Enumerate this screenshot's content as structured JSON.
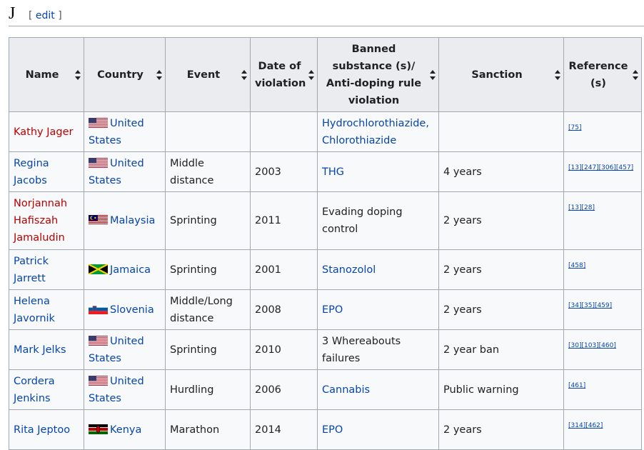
{
  "heading": {
    "title": "J",
    "edit_label": "edit",
    "open_bracket": "[",
    "close_bracket": "]"
  },
  "table": {
    "headers": [
      "Name",
      "Country",
      "Event",
      "Date of violation",
      "Banned substance (s)/ Anti-doping rule violation",
      "Sanction",
      "Reference (s)"
    ],
    "rows": [
      {
        "name": "Kathy Jager",
        "name_link": "red",
        "country": "United States",
        "flag": "us-flag-icon",
        "event": "",
        "date": "",
        "substance": "Hydrochlorothiazide, Chlorothiazide",
        "substance_link": true,
        "sanction": "",
        "refs": "[75]"
      },
      {
        "name": "Regina Jacobs",
        "name_link": "blue",
        "country": "United States",
        "flag": "us-flag-icon",
        "event": "Middle distance",
        "date": "2003",
        "substance": "THG",
        "substance_link": true,
        "sanction": "4 years",
        "refs": "[13][247][306][457]"
      },
      {
        "name": "Norjannah Hafiszah Jamaludin",
        "name_link": "red",
        "country": "Malaysia",
        "flag": "my-flag-icon",
        "event": "Sprinting",
        "date": "2011",
        "substance": "Evading doping control",
        "substance_link": false,
        "sanction": "2 years",
        "refs": "[13][28]"
      },
      {
        "name": "Patrick Jarrett",
        "name_link": "blue",
        "country": "Jamaica",
        "flag": "jm-flag-icon",
        "event": "Sprinting",
        "date": "2001",
        "substance": "Stanozolol",
        "substance_link": true,
        "sanction": "2 years",
        "refs": "[458]"
      },
      {
        "name": "Helena Javornik",
        "name_link": "blue",
        "country": "Slovenia",
        "flag": "si-flag-icon",
        "event": "Middle/Long distance",
        "date": "2008",
        "substance": "EPO",
        "substance_link": true,
        "sanction": "2 years",
        "refs": "[34][35][459]"
      },
      {
        "name": "Mark Jelks",
        "name_link": "blue",
        "country": "United States",
        "flag": "us-flag-icon",
        "event": "Sprinting",
        "date": "2010",
        "substance": "3 Whereabouts failures",
        "substance_link": false,
        "sanction": "2 year ban",
        "refs": "[30][103][460]"
      },
      {
        "name": "Cordera Jenkins",
        "name_link": "blue",
        "country": "United States",
        "flag": "us-flag-icon",
        "event": "Hurdling",
        "date": "2006",
        "substance": "Cannabis",
        "substance_link": true,
        "sanction": "Public warning",
        "refs": "[461]"
      },
      {
        "name": "Rita Jeptoo",
        "name_link": "blue",
        "country": "Kenya",
        "flag": "ke-flag-icon",
        "event": "Marathon",
        "date": "2014",
        "substance": "EPO",
        "substance_link": true,
        "sanction": "2 years",
        "refs": "[314][462]"
      }
    ]
  },
  "colors": {
    "link": "#0645ad",
    "redlink": "#ba0000",
    "header_bg": "#eaecf0",
    "cell_bg": "#f8f9fa",
    "border": "#a2a9b1"
  }
}
